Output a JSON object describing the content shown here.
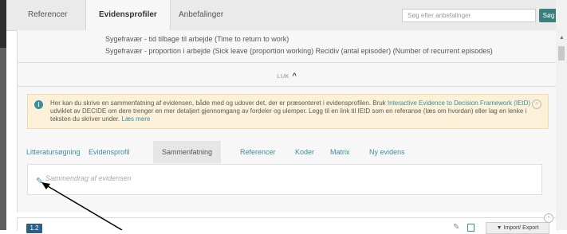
{
  "nav": {
    "tabs": [
      "Referencer",
      "Evidensprofiler",
      "Anbefalinger"
    ],
    "search_placeholder": "Søg efter anbefalinger",
    "search_button": "Søg"
  },
  "outcomes": {
    "line1": "Sygefravær - tid tilbage til arbejde (Time to return to work)",
    "line2": "Sygefravær - proportion i arbejde (Sick leave (proportion working)   Recidiv (antal episoder) (Number of recurrent episodes)"
  },
  "collapse_label": "LUK",
  "info": {
    "part1": "Her kan du skrive en sammenfatning af evidensen, både med og udover det, der er præsenteret i evidensprofilen. Bruk ",
    "link1": "Interactive Evidence to Decision Framework (IEtD)",
    "part2": " udviklet av DECIDE om dere trenger en mer detaljert gjennomgang av fordeler og ulemper. Legg til en link til IEtD som en referanse (læs om hvordan) eller lag en lenke i teksten du skriver under.  ",
    "link2": "Læs mere"
  },
  "subtabs": [
    "Litteratursøgning",
    "Evidensprofil",
    "Sammenfatning",
    "Referencer",
    "Koder",
    "Matrix",
    "Ny evidens"
  ],
  "summary_placeholder": "Sammendrag af evidensen",
  "card": {
    "badge": "1.2",
    "import_export": "Import/ Export"
  },
  "colors": {
    "accent": "#3b8ea0",
    "search_button": "#3b7f7e",
    "badge": "#2a5f86",
    "info_bg": "#fbf1d8"
  }
}
